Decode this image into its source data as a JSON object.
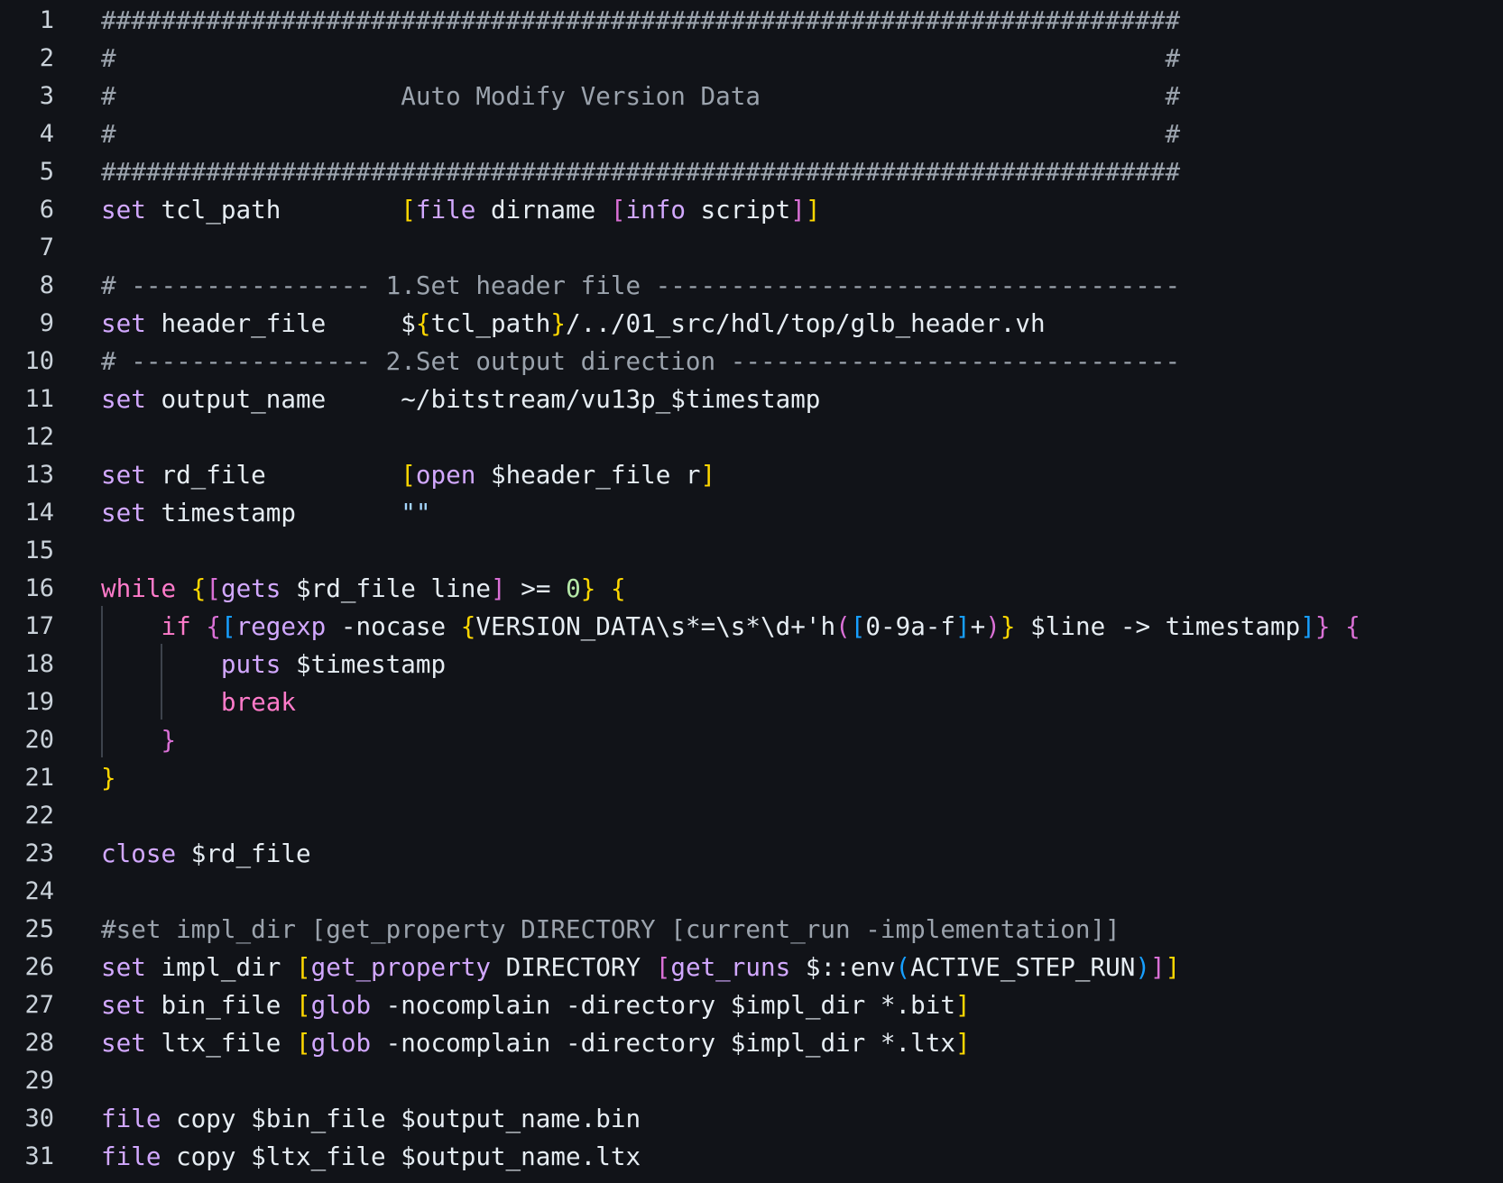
{
  "editor": {
    "background": "#111318",
    "colors": {
      "text": "#e6edf3",
      "keyword": "#d2a8ff",
      "keyword_ctrl": "#ff7bca",
      "comment": "#9ba3ad",
      "bracket_yellow": "#ffd700",
      "bracket_purple": "#da70d6",
      "bracket_blue": "#179fff",
      "number": "#b5e8a8",
      "string": "#a5d6ff",
      "line_number": "#c9d1d9"
    },
    "lines": [
      {
        "n": "1",
        "tokens": [
          [
            "comment",
            "########################################################################"
          ]
        ]
      },
      {
        "n": "2",
        "tokens": [
          [
            "comment",
            "#                                                                      #"
          ]
        ]
      },
      {
        "n": "3",
        "tokens": [
          [
            "comment",
            "#                   Auto Modify Version Data                           #"
          ]
        ]
      },
      {
        "n": "4",
        "tokens": [
          [
            "comment",
            "#                                                                      #"
          ]
        ]
      },
      {
        "n": "5",
        "tokens": [
          [
            "comment",
            "########################################################################"
          ]
        ]
      },
      {
        "n": "6",
        "tokens": [
          [
            "keyword",
            "set"
          ],
          [
            "text",
            " tcl_path        "
          ],
          [
            "bracket-y",
            "["
          ],
          [
            "keyword",
            "file"
          ],
          [
            "text",
            " dirname "
          ],
          [
            "bracket-p",
            "["
          ],
          [
            "keyword",
            "info"
          ],
          [
            "text",
            " script"
          ],
          [
            "bracket-p",
            "]"
          ],
          [
            "bracket-y",
            "]"
          ]
        ]
      },
      {
        "n": "7",
        "tokens": []
      },
      {
        "n": "8",
        "tokens": [
          [
            "comment",
            "# ---------------- 1.Set header file -----------------------------------"
          ]
        ]
      },
      {
        "n": "9",
        "tokens": [
          [
            "keyword",
            "set"
          ],
          [
            "text",
            " header_file     $"
          ],
          [
            "bracket-y",
            "{"
          ],
          [
            "text",
            "tcl_path"
          ],
          [
            "bracket-y",
            "}"
          ],
          [
            "text",
            "/../01_src/hdl/top/glb_header.vh"
          ]
        ]
      },
      {
        "n": "10",
        "tokens": [
          [
            "comment",
            "# ---------------- 2.Set output direction ------------------------------"
          ]
        ]
      },
      {
        "n": "11",
        "tokens": [
          [
            "keyword",
            "set"
          ],
          [
            "text",
            " output_name     ~/bitstream/vu13p_$timestamp"
          ]
        ]
      },
      {
        "n": "12",
        "tokens": []
      },
      {
        "n": "13",
        "tokens": [
          [
            "keyword",
            "set"
          ],
          [
            "text",
            " rd_file         "
          ],
          [
            "bracket-y",
            "["
          ],
          [
            "keyword",
            "open"
          ],
          [
            "text",
            " $header_file r"
          ],
          [
            "bracket-y",
            "]"
          ]
        ]
      },
      {
        "n": "14",
        "tokens": [
          [
            "keyword",
            "set"
          ],
          [
            "text",
            " timestamp       "
          ],
          [
            "string",
            "\"\""
          ]
        ]
      },
      {
        "n": "15",
        "tokens": []
      },
      {
        "n": "16",
        "tokens": [
          [
            "keyword-ctrl",
            "while"
          ],
          [
            "text",
            " "
          ],
          [
            "bracket-y",
            "{"
          ],
          [
            "bracket-p",
            "["
          ],
          [
            "keyword",
            "gets"
          ],
          [
            "text",
            " $rd_file line"
          ],
          [
            "bracket-p",
            "]"
          ],
          [
            "text",
            " >= "
          ],
          [
            "number",
            "0"
          ],
          [
            "bracket-y",
            "}"
          ],
          [
            "text",
            " "
          ],
          [
            "bracket-y",
            "{"
          ]
        ]
      },
      {
        "n": "17",
        "tokens": [
          [
            "text",
            "    "
          ],
          [
            "keyword-ctrl",
            "if"
          ],
          [
            "text",
            " "
          ],
          [
            "bracket-p",
            "{"
          ],
          [
            "bracket-b",
            "["
          ],
          [
            "keyword",
            "regexp"
          ],
          [
            "text",
            " -nocase "
          ],
          [
            "bracket-y",
            "{"
          ],
          [
            "text",
            "VERSION_DATA\\s*=\\s*\\d+'h"
          ],
          [
            "bracket-p",
            "("
          ],
          [
            "bracket-b",
            "["
          ],
          [
            "text",
            "0-9a-f"
          ],
          [
            "bracket-b",
            "]"
          ],
          [
            "text",
            "+"
          ],
          [
            "bracket-p",
            ")"
          ],
          [
            "bracket-y",
            "}"
          ],
          [
            "text",
            " $line -> timestamp"
          ],
          [
            "bracket-b",
            "]"
          ],
          [
            "bracket-p",
            "}"
          ],
          [
            "text",
            " "
          ],
          [
            "bracket-p",
            "{"
          ]
        ]
      },
      {
        "n": "18",
        "tokens": [
          [
            "text",
            "        "
          ],
          [
            "keyword",
            "puts"
          ],
          [
            "text",
            " $timestamp"
          ]
        ]
      },
      {
        "n": "19",
        "tokens": [
          [
            "text",
            "        "
          ],
          [
            "keyword-ctrl",
            "break"
          ]
        ]
      },
      {
        "n": "20",
        "tokens": [
          [
            "text",
            "    "
          ],
          [
            "bracket-p",
            "}"
          ]
        ]
      },
      {
        "n": "21",
        "tokens": [
          [
            "bracket-y",
            "}"
          ]
        ]
      },
      {
        "n": "22",
        "tokens": []
      },
      {
        "n": "23",
        "tokens": [
          [
            "keyword",
            "close"
          ],
          [
            "text",
            " $rd_file"
          ]
        ]
      },
      {
        "n": "24",
        "tokens": []
      },
      {
        "n": "25",
        "tokens": [
          [
            "comment",
            "#set impl_dir [get_property DIRECTORY [current_run -implementation]]"
          ]
        ]
      },
      {
        "n": "26",
        "tokens": [
          [
            "keyword",
            "set"
          ],
          [
            "text",
            " impl_dir "
          ],
          [
            "bracket-y",
            "["
          ],
          [
            "keyword",
            "get_property"
          ],
          [
            "text",
            " DIRECTORY "
          ],
          [
            "bracket-p",
            "["
          ],
          [
            "keyword",
            "get_runs"
          ],
          [
            "text",
            " $::env"
          ],
          [
            "bracket-b",
            "("
          ],
          [
            "text",
            "ACTIVE_STEP_RUN"
          ],
          [
            "bracket-b",
            ")"
          ],
          [
            "bracket-p",
            "]"
          ],
          [
            "bracket-y",
            "]"
          ]
        ]
      },
      {
        "n": "27",
        "tokens": [
          [
            "keyword",
            "set"
          ],
          [
            "text",
            " bin_file "
          ],
          [
            "bracket-y",
            "["
          ],
          [
            "keyword",
            "glob"
          ],
          [
            "text",
            " -nocomplain -directory $impl_dir *.bit"
          ],
          [
            "bracket-y",
            "]"
          ]
        ]
      },
      {
        "n": "28",
        "tokens": [
          [
            "keyword",
            "set"
          ],
          [
            "text",
            " ltx_file "
          ],
          [
            "bracket-y",
            "["
          ],
          [
            "keyword",
            "glob"
          ],
          [
            "text",
            " -nocomplain -directory $impl_dir *.ltx"
          ],
          [
            "bracket-y",
            "]"
          ]
        ]
      },
      {
        "n": "29",
        "tokens": []
      },
      {
        "n": "30",
        "tokens": [
          [
            "keyword",
            "file"
          ],
          [
            "text",
            " copy $bin_file $output_name.bin"
          ]
        ]
      },
      {
        "n": "31",
        "tokens": [
          [
            "keyword",
            "file"
          ],
          [
            "text",
            " copy $ltx_file $output_name.ltx"
          ]
        ]
      }
    ]
  }
}
